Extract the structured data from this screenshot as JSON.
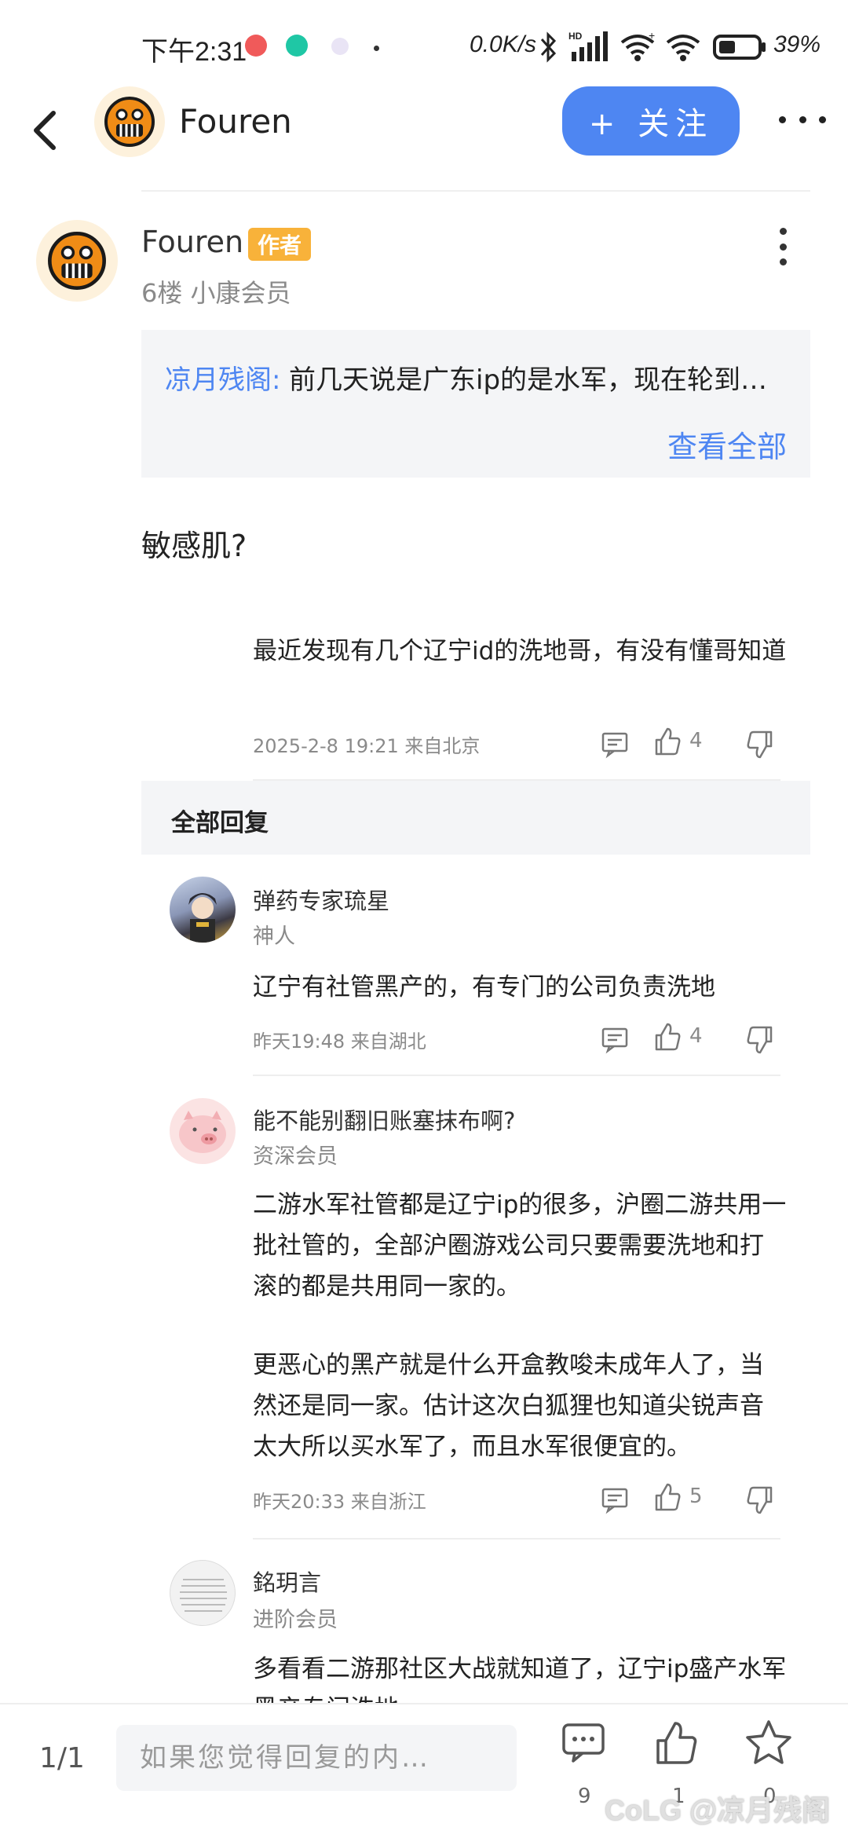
{
  "status_bar": {
    "time": "下午2:31",
    "net_speed": "0.0K/s",
    "battery": "39%"
  },
  "header": {
    "username": "Fouren",
    "follow_label": "+ 关注"
  },
  "floor": {
    "author": "Fouren",
    "author_badge": "作者",
    "meta": "6楼  小康会员",
    "quote_user": "凉月残阁:",
    "quote_text": "前几天说是广东ip的是水军，现在轮到…",
    "quote_more": "查看全部",
    "body": "敏感肌?"
  },
  "sub_post": {
    "text": "最近发现有几个辽宁id的洗地哥，有没有懂哥知道",
    "meta": "2025-2-8 19:21  来自北京",
    "likes": "4"
  },
  "all_replies_label": "全部回复",
  "replies": [
    {
      "name": "弹药专家琉星",
      "level": "神人",
      "text": "辽宁有社管黑产的，有专门的公司负责洗地",
      "meta": "昨天19:48  来自湖北",
      "likes": "4"
    },
    {
      "name": "能不能别翻旧账塞抹布啊?",
      "level": "资深会员",
      "text": "二游水军社管都是辽宁ip的很多，沪圈二游共用一批社管的，全部沪圈游戏公司只要需要洗地和打滚的都是共用同一家的。",
      "text2": "更恶心的黑产就是什么开盒教唆未成年人了，当然还是同一家。估计这次白狐狸也知道尖锐声音太大所以买水军了，而且水军很便宜的。",
      "meta": "昨天20:33  来自浙江",
      "likes": "5"
    },
    {
      "name": "銘玥言",
      "level": "进阶会员",
      "text": "多看看二游那社区大战就知道了，辽宁ip盛产水军黑产专门洗地"
    }
  ],
  "bottom_bar": {
    "page": "1/1",
    "input_placeholder": "如果您觉得回复的内…",
    "comment_count": "9",
    "like_count": "1",
    "fav_count": "0",
    "watermark": "CoLG @凉月残阁"
  },
  "colors": {
    "accent": "#4e86f2",
    "badge": "#f8b23a",
    "avatar_face": "#f08c16"
  }
}
